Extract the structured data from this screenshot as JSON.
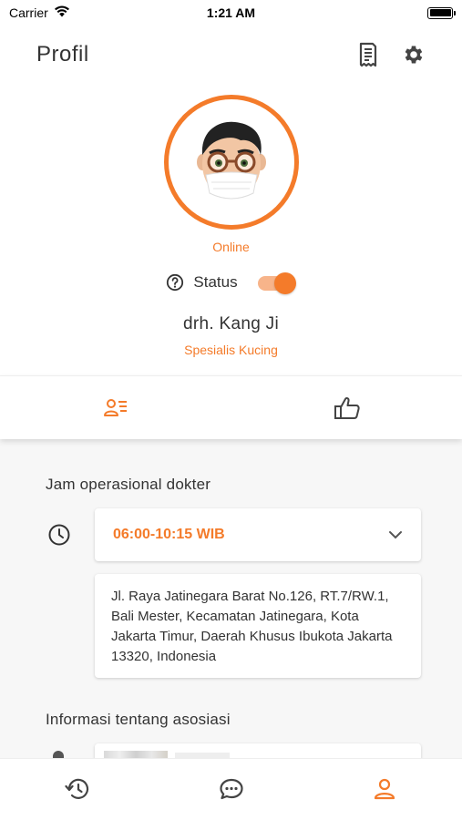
{
  "status_bar": {
    "carrier": "Carrier",
    "time": "1:21 AM"
  },
  "header": {
    "title": "Profil",
    "icons": [
      "receipt-icon",
      "gear-icon"
    ]
  },
  "profile": {
    "online_label": "Online",
    "status_label": "Status",
    "status_toggle_on": true,
    "name": "drh. Kang Ji",
    "specialty": "Spesialis Kucing"
  },
  "tabs": {
    "items": [
      "info-list-icon",
      "thumbs-up-icon"
    ],
    "active_index": 0
  },
  "operational": {
    "section_title": "Jam operasional dokter",
    "hours": "06:00-10:15 WIB",
    "address": "Jl. Raya Jatinegara Barat No.126, RT.7/RW.1, Bali Mester, Kecamatan Jatinegara, Kota Jakarta Timur, Daerah Khusus Ibukota Jakarta 13320, Indonesia"
  },
  "association": {
    "section_title": "Informasi tentang asosiasi"
  },
  "bottom_nav": {
    "items": [
      "history-icon",
      "chat-icon",
      "profile-icon"
    ],
    "active_index": 2
  },
  "colors": {
    "accent": "#f47b2a",
    "toggle_track": "#f7b48a",
    "content_bg": "#f7f7f7",
    "icon_gray": "#555555"
  }
}
